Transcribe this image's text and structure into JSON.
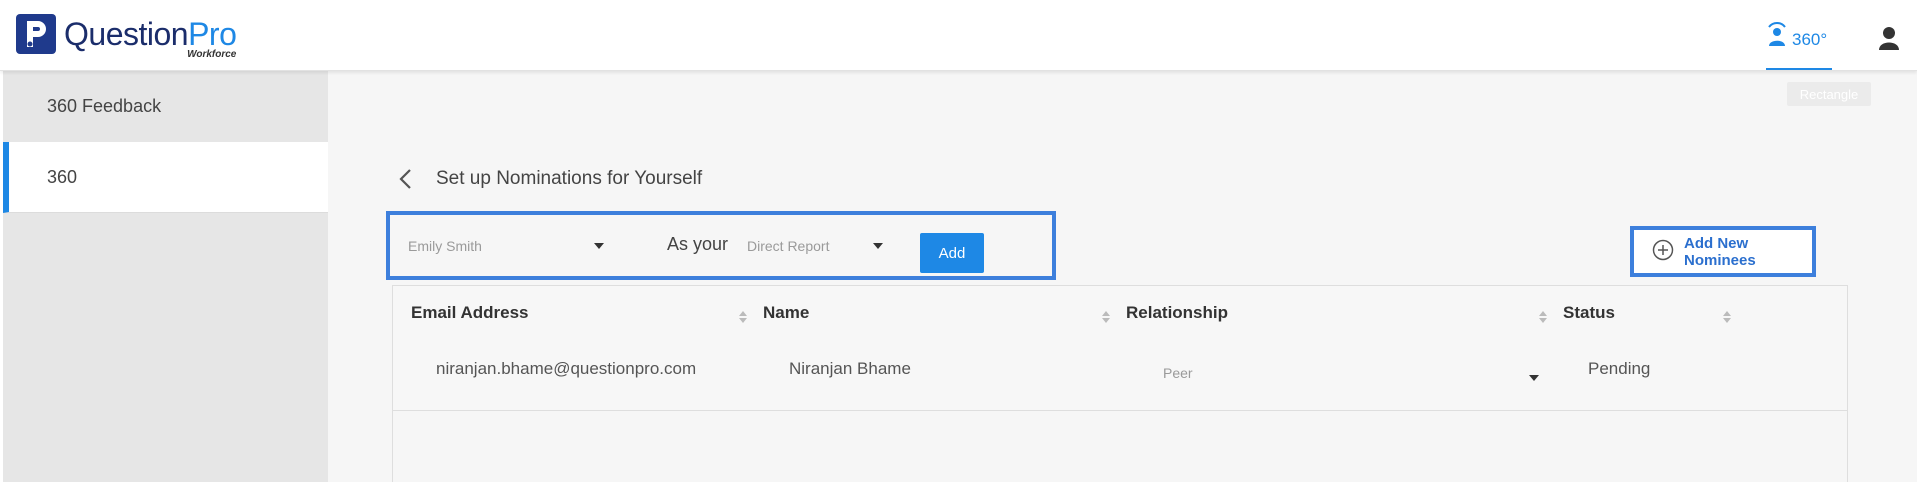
{
  "header": {
    "logo_word_main": "Question",
    "logo_word_accent": "Pro",
    "logo_sub": "Workforce",
    "nav_360_label": "360°",
    "tooltip": "Rectangle"
  },
  "sidebar": {
    "items": [
      {
        "label": "360 Feedback"
      },
      {
        "label": "360"
      }
    ]
  },
  "main": {
    "title": "Set up Nominations for Yourself",
    "nominee_select": "Emily Smith",
    "as_your_label": "As your",
    "relationship_select": "Direct Report",
    "add_button": "Add",
    "add_new_nominees": "Add New Nominees"
  },
  "table": {
    "columns": [
      "Email Address",
      "Name",
      "Relationship",
      "Status"
    ],
    "rows": [
      {
        "email": "niranjan.bhame@questionpro.com",
        "name": "Niranjan Bhame",
        "relationship": "Peer",
        "status": "Pending"
      }
    ]
  },
  "colors": {
    "accent": "#1e88e5",
    "highlight_box": "#3d7fdc",
    "logo_navy": "#1f3a8c",
    "sidebar_bg": "#e6e6e6",
    "main_bg": "#f6f6f6"
  }
}
